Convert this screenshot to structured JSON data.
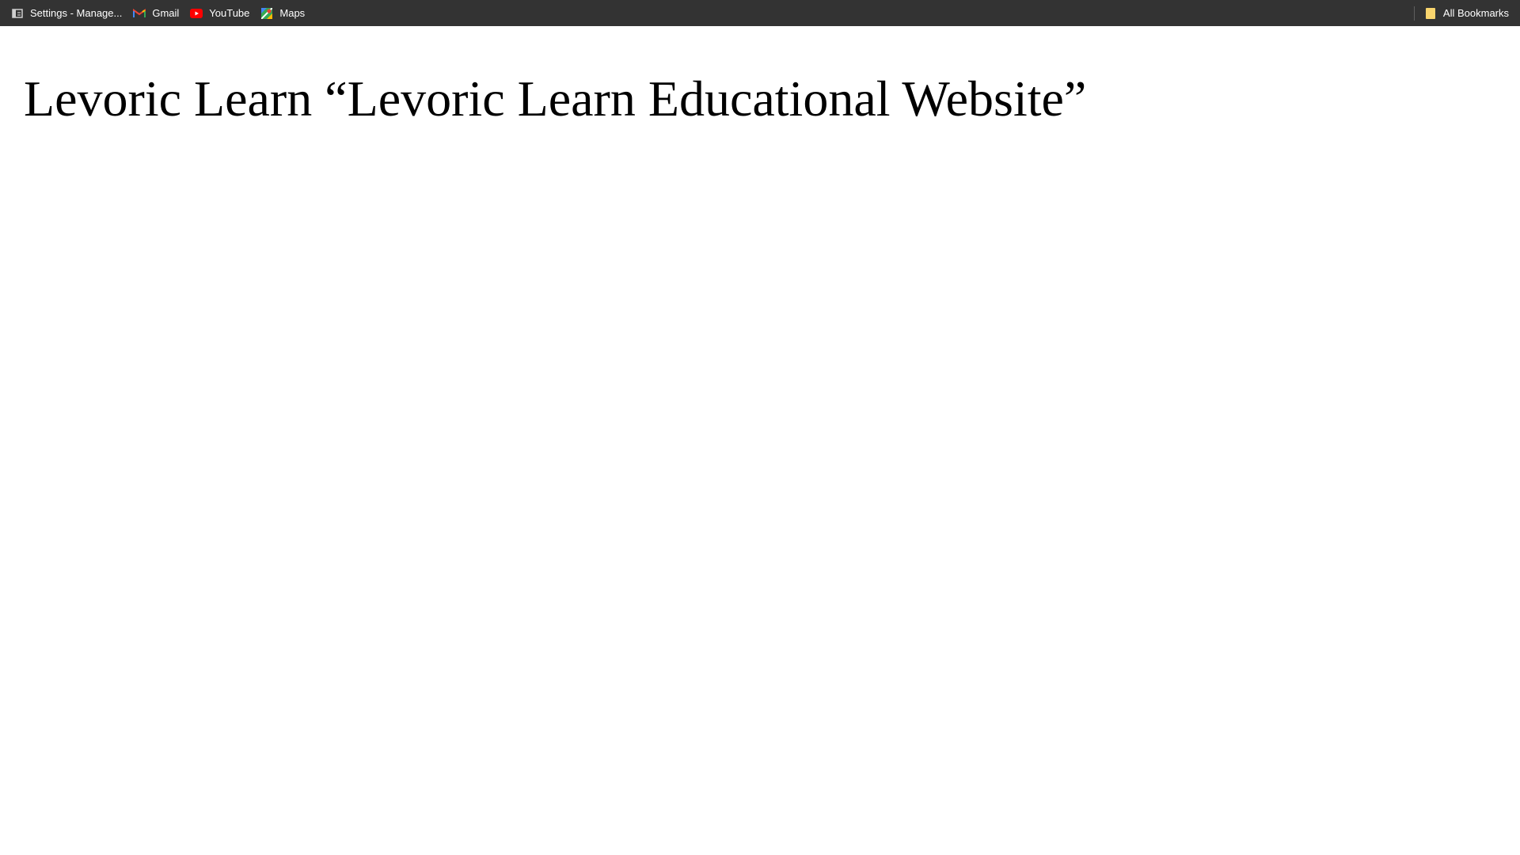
{
  "bookmarks_bar": {
    "items": [
      {
        "label": "Settings - Manage...",
        "icon": "settings-page-icon"
      },
      {
        "label": "Gmail",
        "icon": "gmail-icon"
      },
      {
        "label": "YouTube",
        "icon": "youtube-icon"
      },
      {
        "label": "Maps",
        "icon": "maps-icon"
      }
    ],
    "all_bookmarks": {
      "label": "All Bookmarks",
      "icon": "folder-icon"
    }
  },
  "page": {
    "title": "Levoric Learn “Levoric Learn Educational Website”"
  },
  "colors": {
    "bar_background": "#333333",
    "bar_text": "#ffffff",
    "page_background": "#ffffff",
    "title_text": "#000000",
    "youtube_red": "#ff0000",
    "folder_yellow": "#f9d56e"
  }
}
